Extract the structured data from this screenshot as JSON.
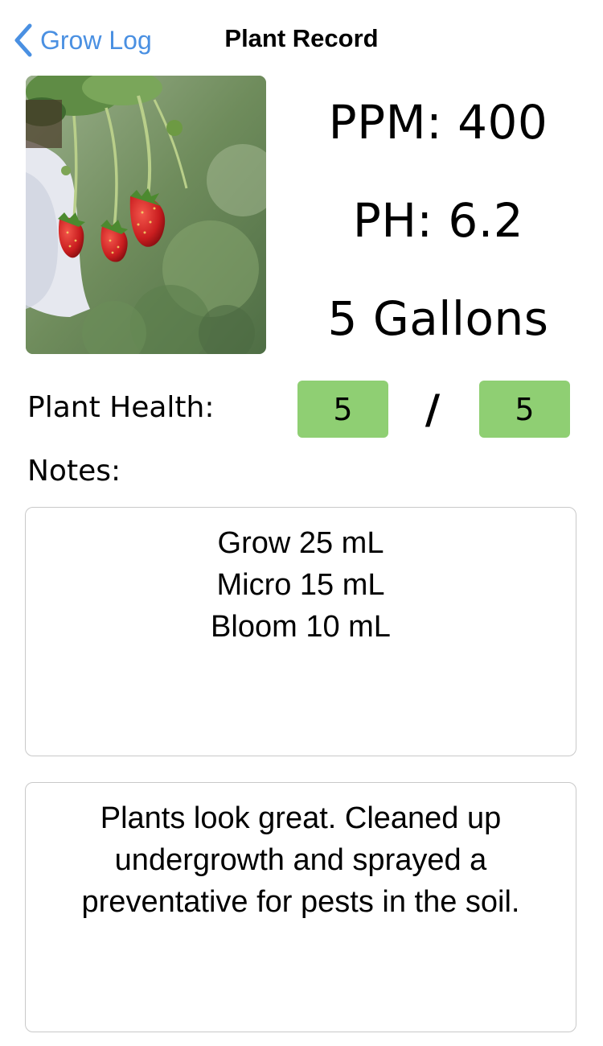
{
  "nav": {
    "back_label": "Grow Log",
    "back_icon": "chevron-left-icon",
    "title": "Plant Record"
  },
  "photo": {
    "subject": "strawberry-plant-photo"
  },
  "stats": {
    "ppm": "PPM: 400",
    "ph": "PH: 6.2",
    "volume": "5 Gallons"
  },
  "health": {
    "label": "Plant Health:",
    "score": "5",
    "separator": "/",
    "max": "5"
  },
  "notes": {
    "label": "Notes:",
    "nutrients": "Grow 25 mL\nMicro 15 mL\nBloom 10 mL",
    "observations": "Plants look great. Cleaned up undergrowth and sprayed a preventative for pests in the soil."
  },
  "colors": {
    "accent": "#4a90e2",
    "score_bg": "#8fcf73",
    "border": "#c9c9c9"
  }
}
